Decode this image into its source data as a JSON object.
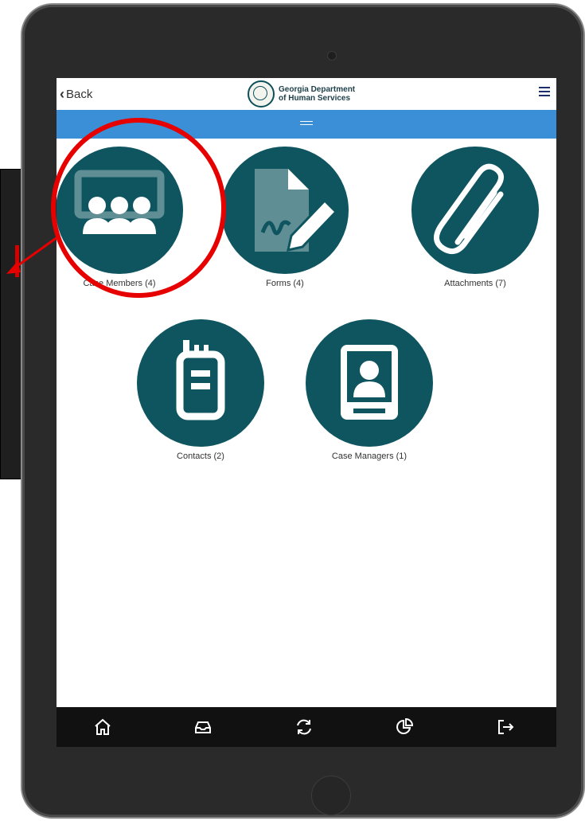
{
  "header": {
    "back_label": "Back",
    "logo_line1": "Georgia Department",
    "logo_line2": "of Human Services"
  },
  "tiles": [
    {
      "label": "Case Members (4)",
      "icon": "people-group-icon"
    },
    {
      "label": "Forms (4)",
      "icon": "document-pen-icon"
    },
    {
      "label": "Attachments (7)",
      "icon": "paperclip-icon"
    },
    {
      "label": "Contacts (2)",
      "icon": "radio-contact-icon"
    },
    {
      "label": "Case Managers (1)",
      "icon": "person-card-icon"
    }
  ],
  "bottom_nav": [
    {
      "icon": "home-icon"
    },
    {
      "icon": "inbox-icon"
    },
    {
      "icon": "refresh-icon"
    },
    {
      "icon": "pie-chart-icon"
    },
    {
      "icon": "logout-icon"
    }
  ],
  "colors": {
    "tile_bg": "#0e5560",
    "accent_bar": "#3a8fd6",
    "nav_bg": "#111111",
    "annotation": "#e60000"
  }
}
